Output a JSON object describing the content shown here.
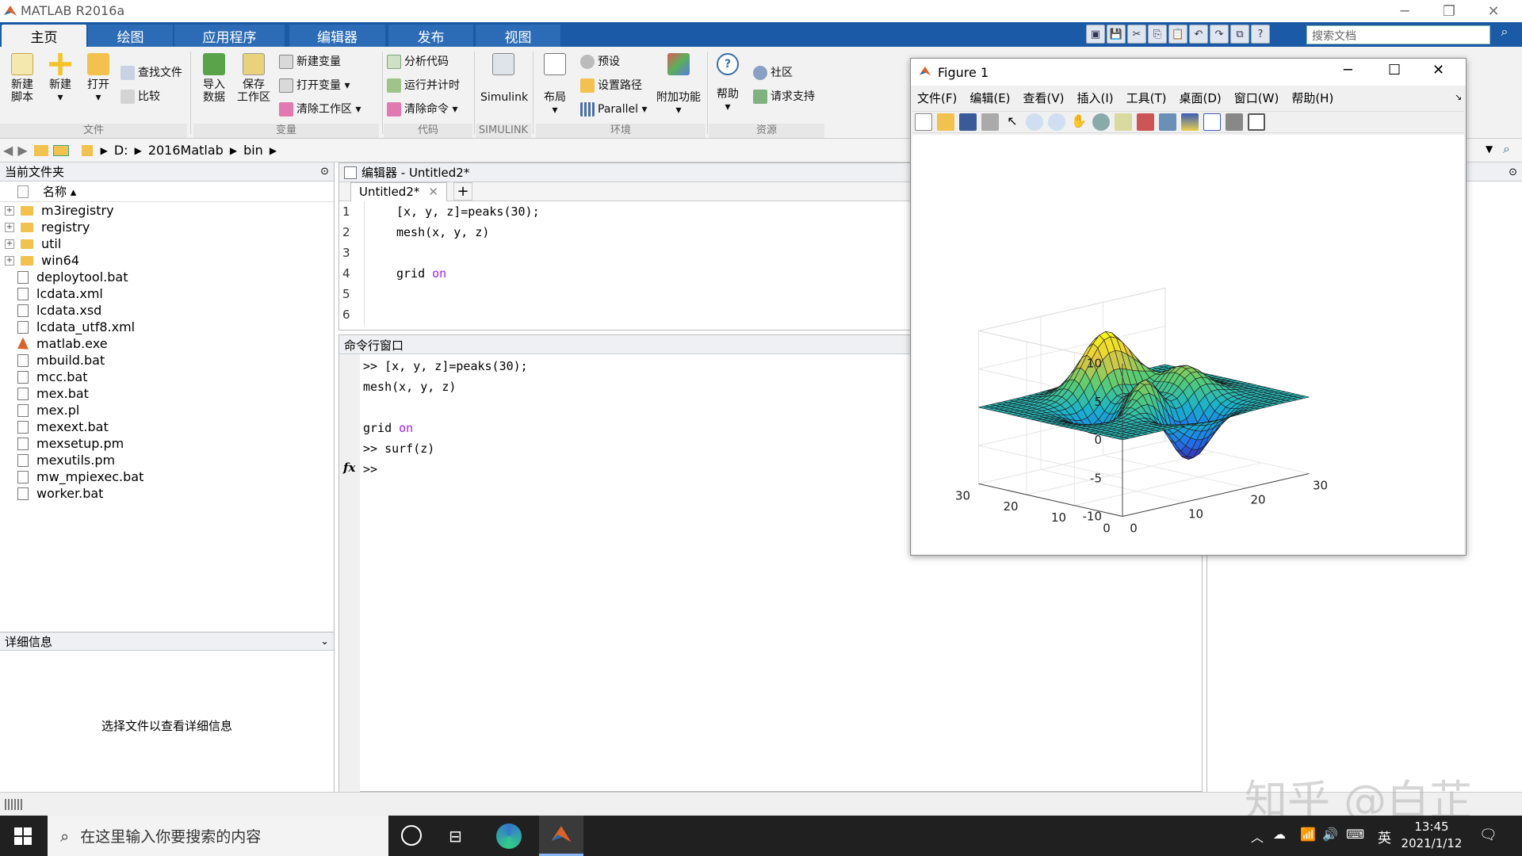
{
  "app": {
    "title": "MATLAB R2016a"
  },
  "tabs": [
    "主页",
    "绘图",
    "应用程序",
    "编辑器",
    "发布",
    "视图"
  ],
  "search": {
    "placeholder": "搜索文档"
  },
  "ribbon": {
    "file": {
      "new_script": "新建\n脚本",
      "new": "新建",
      "open": "打开",
      "find_files": "查找文件",
      "compare": "比较",
      "group": "文件"
    },
    "variable": {
      "import": "导入\n数据",
      "save_ws": "保存\n工作区",
      "new_var": "新建变量",
      "open_var": "打开变量",
      "clear_ws": "清除工作区",
      "group": "变量"
    },
    "code": {
      "analyze": "分析代码",
      "run_time": "运行并计时",
      "clear_cmd": "清除命令",
      "group": "代码"
    },
    "simulink": {
      "label": "Simulink",
      "group": "SIMULINK"
    },
    "env": {
      "layout": "布局",
      "prefs": "预设",
      "set_path": "设置路径",
      "parallel": "Parallel",
      "addons": "附加功能",
      "group": "环境"
    },
    "resources": {
      "help": "帮助",
      "community": "社区",
      "support": "请求支持",
      "group": "资源"
    }
  },
  "address": {
    "parts": [
      "D:",
      "2016Matlab",
      "bin"
    ]
  },
  "current_folder": {
    "title": "当前文件夹",
    "col_name": "名称 ▴",
    "folders": [
      "m3iregistry",
      "registry",
      "util",
      "win64"
    ],
    "files": [
      "deploytool.bat",
      "lcdata.xml",
      "lcdata.xsd",
      "lcdata_utf8.xml",
      "matlab.exe",
      "mbuild.bat",
      "mcc.bat",
      "mex.bat",
      "mex.pl",
      "mexext.bat",
      "mexsetup.pm",
      "mexutils.pm",
      "mw_mpiexec.bat",
      "worker.bat"
    ]
  },
  "details": {
    "title": "详细信息",
    "empty": "选择文件以查看详细信息"
  },
  "editor": {
    "title": "编辑器 - Untitled2*",
    "tab": "Untitled2*",
    "lines": [
      {
        "n": "1",
        "text": "[x, y, z]=peaks(30);",
        "kw": ""
      },
      {
        "n": "2",
        "text": "mesh(x, y, z)",
        "kw": ""
      },
      {
        "n": "3",
        "text": "",
        "kw": ""
      },
      {
        "n": "4",
        "text": "grid ",
        "kw": "on"
      },
      {
        "n": "5",
        "text": "",
        "kw": ""
      },
      {
        "n": "6",
        "text": "",
        "kw": ""
      }
    ]
  },
  "command_window": {
    "title": "命令行窗口",
    "lines": [
      {
        "text": ">> [x, y, z]=peaks(30);",
        "kw": ""
      },
      {
        "text": "mesh(x, y, z)",
        "kw": ""
      },
      {
        "text": "",
        "kw": ""
      },
      {
        "text": "grid ",
        "kw": "on"
      },
      {
        "text": ">> surf(z)",
        "kw": ""
      },
      {
        "text": ">>",
        "kw": ""
      }
    ],
    "fx": "fx"
  },
  "figure": {
    "title": "Figure 1",
    "menu": [
      "文件(F)",
      "编辑(E)",
      "查看(V)",
      "插入(I)",
      "工具(T)",
      "桌面(D)",
      "窗口(W)",
      "帮助(H)"
    ],
    "z_ticks": [
      "10",
      "5",
      "0",
      "-5",
      "-10"
    ],
    "y_ticks": [
      "30",
      "20",
      "10",
      "0"
    ],
    "x_ticks": [
      "0",
      "10",
      "20",
      "30"
    ]
  },
  "taskbar": {
    "search": "在这里输入你要搜索的内容",
    "ime": "英",
    "time": "13:45",
    "date": "2021/1/12"
  },
  "watermark": "知乎 @白芷",
  "colors": {
    "tab_bar": "#1a5aa6",
    "keyword": "#a020f0",
    "taskbar": "#202020"
  }
}
